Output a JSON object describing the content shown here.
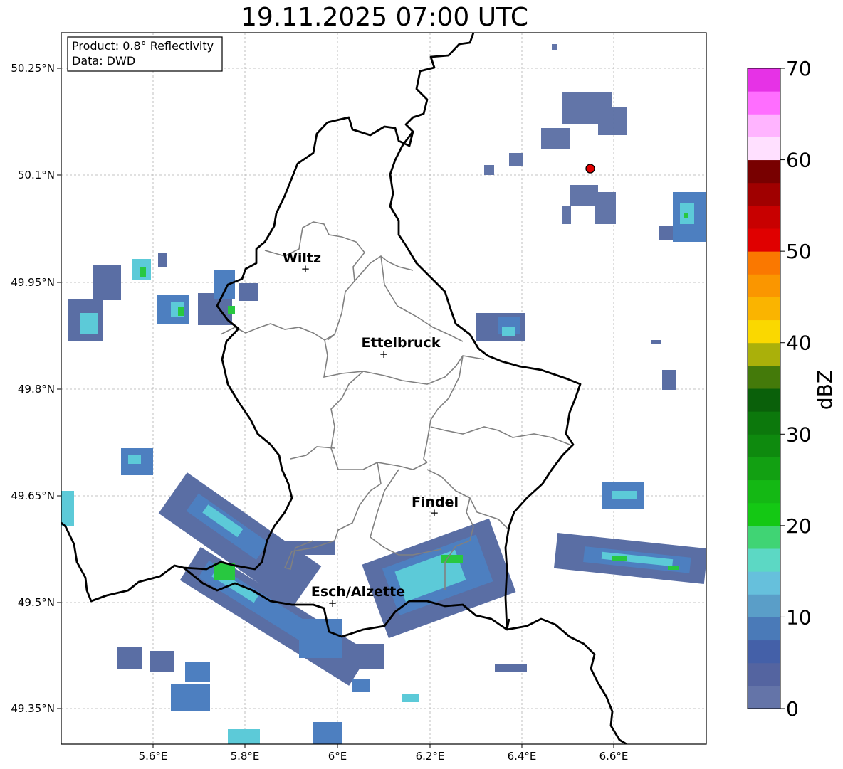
{
  "title": "19.11.2025 07:00 UTC",
  "info_box": {
    "product": "Product: 0.8° Reflectivity",
    "data": "Data: DWD"
  },
  "axes": {
    "lon_ticks": [
      "5.6°E",
      "5.8°E",
      "6°E",
      "6.2°E",
      "6.4°E",
      "6.6°E"
    ],
    "lat_ticks": [
      "50.25°N",
      "50.1°N",
      "49.95°N",
      "49.8°N",
      "49.65°N",
      "49.5°N",
      "49.35°N"
    ]
  },
  "cities": [
    {
      "name": "Wiltz"
    },
    {
      "name": "Ettelbruck"
    },
    {
      "name": "Findel"
    },
    {
      "name": "Esch/Alzette"
    }
  ],
  "colorbar": {
    "label": "dBZ",
    "ticks": [
      "70",
      "60",
      "50",
      "40",
      "30",
      "20",
      "10",
      "0"
    ],
    "colors": [
      "#6474a8",
      "#5464a0",
      "#4460a8",
      "#4a7ab8",
      "#5a9ec8",
      "#66c0dc",
      "#5cd8c4",
      "#40d474",
      "#14c814",
      "#14b814",
      "#12a012",
      "#0e8a0e",
      "#0c780c",
      "#0a600a",
      "#447a0a",
      "#aab00a",
      "#fad800",
      "#fab400",
      "#fa9600",
      "#fa7800",
      "#e00000",
      "#c80000",
      "#a00000",
      "#780000",
      "#ffe0ff",
      "#ffb4ff",
      "#ff6eff",
      "#e632e6"
    ]
  },
  "palette": {
    "rain_light": "#5a6ea4",
    "rain_mid": "#4d7fc0",
    "rain_cyan": "#5ccad8",
    "rain_green": "#28c840",
    "radar_site": "#e00000"
  }
}
